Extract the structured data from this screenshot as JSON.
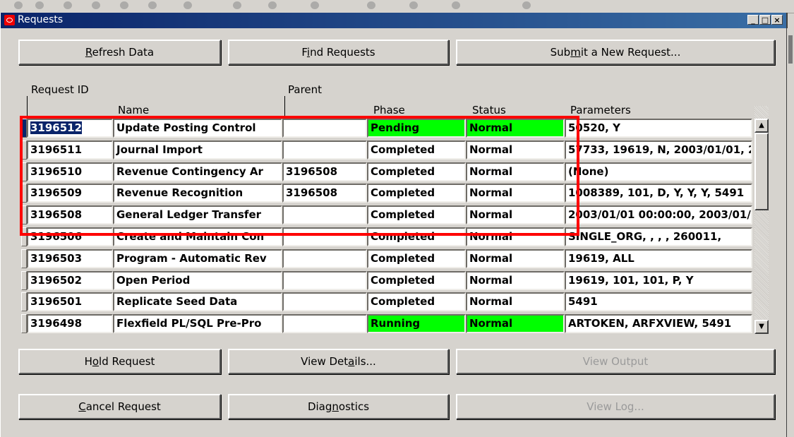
{
  "window": {
    "title": "Requests"
  },
  "top_buttons": [
    {
      "label_pre": "",
      "label_u": "R",
      "label_post": "efresh Data"
    },
    {
      "label_pre": "F",
      "label_u": "i",
      "label_post": "nd Requests"
    },
    {
      "label_pre": "Sub",
      "label_u": "m",
      "label_post": "it a New Request..."
    }
  ],
  "columns": {
    "request_id": "Request ID",
    "name": "Name",
    "parent": "Parent",
    "phase": "Phase",
    "status": "Status",
    "parameters": "Parameters"
  },
  "rows": [
    {
      "id": "3196512",
      "name": "Update Posting Control",
      "parent": "",
      "phase": "Pending",
      "status": "Normal",
      "params": "50520, Y",
      "phase_color": "#00ff00",
      "status_color": "#00ff00"
    },
    {
      "id": "3196511",
      "name": "Journal Import",
      "parent": "",
      "phase": "Completed",
      "status": "Normal",
      "params": "57733, 19619, N, 2003/01/01, 2",
      "phase_color": "#ffffff",
      "status_color": "#ffffff"
    },
    {
      "id": "3196510",
      "name": "Revenue Contingency Ar",
      "parent": "3196508",
      "phase": "Completed",
      "status": "Normal",
      "params": "(None)",
      "phase_color": "#ffffff",
      "status_color": "#ffffff"
    },
    {
      "id": "3196509",
      "name": "Revenue Recognition",
      "parent": "3196508",
      "phase": "Completed",
      "status": "Normal",
      "params": "1008389, 101, D, Y, Y, Y, 5491",
      "phase_color": "#ffffff",
      "status_color": "#ffffff"
    },
    {
      "id": "3196508",
      "name": "General Ledger Transfer",
      "parent": "",
      "phase": "Completed",
      "status": "Normal",
      "params": "2003/01/01 00:00:00, 2003/01/",
      "phase_color": "#ffffff",
      "status_color": "#ffffff"
    },
    {
      "id": "3196506",
      "name": "Create and Maintain Con",
      "parent": "",
      "phase": "Completed",
      "status": "Normal",
      "params": "SINGLE_ORG, , , , 260011,",
      "phase_color": "#ffffff",
      "status_color": "#ffffff"
    },
    {
      "id": "3196503",
      "name": "Program - Automatic Rev",
      "parent": "",
      "phase": "Completed",
      "status": "Normal",
      "params": "19619, ALL",
      "phase_color": "#ffffff",
      "status_color": "#ffffff"
    },
    {
      "id": "3196502",
      "name": "Open Period",
      "parent": "",
      "phase": "Completed",
      "status": "Normal",
      "params": "19619, 101, 101, P, Y",
      "phase_color": "#ffffff",
      "status_color": "#ffffff"
    },
    {
      "id": "3196501",
      "name": "Replicate Seed Data",
      "parent": "",
      "phase": "Completed",
      "status": "Normal",
      "params": "5491",
      "phase_color": "#ffffff",
      "status_color": "#ffffff"
    },
    {
      "id": "3196498",
      "name": "Flexfield PL/SQL Pre-Pro",
      "parent": "",
      "phase": "Running",
      "status": "Normal",
      "params": "ARTOKEN, ARFXVIEW, 5491",
      "phase_color": "#00ff00",
      "status_color": "#00ff00"
    }
  ],
  "bottom_buttons": [
    {
      "label_pre": "H",
      "label_u": "o",
      "label_post": "ld Request",
      "enabled": true
    },
    {
      "label_pre": "View Det",
      "label_u": "a",
      "label_post": "ils...",
      "enabled": true
    },
    {
      "label_pre": "View Output",
      "label_u": "",
      "label_post": "",
      "enabled": false
    },
    {
      "label_pre": "",
      "label_u": "C",
      "label_post": "ancel Request",
      "enabled": true
    },
    {
      "label_pre": "Diag",
      "label_u": "n",
      "label_post": "ostics",
      "enabled": true
    },
    {
      "label_pre": "View Log...",
      "label_u": "",
      "label_post": "",
      "enabled": false
    }
  ],
  "colors": {
    "highlight_box": "#ff0000",
    "title_bar": "#0a246a",
    "active_phase": "#00ff00"
  }
}
